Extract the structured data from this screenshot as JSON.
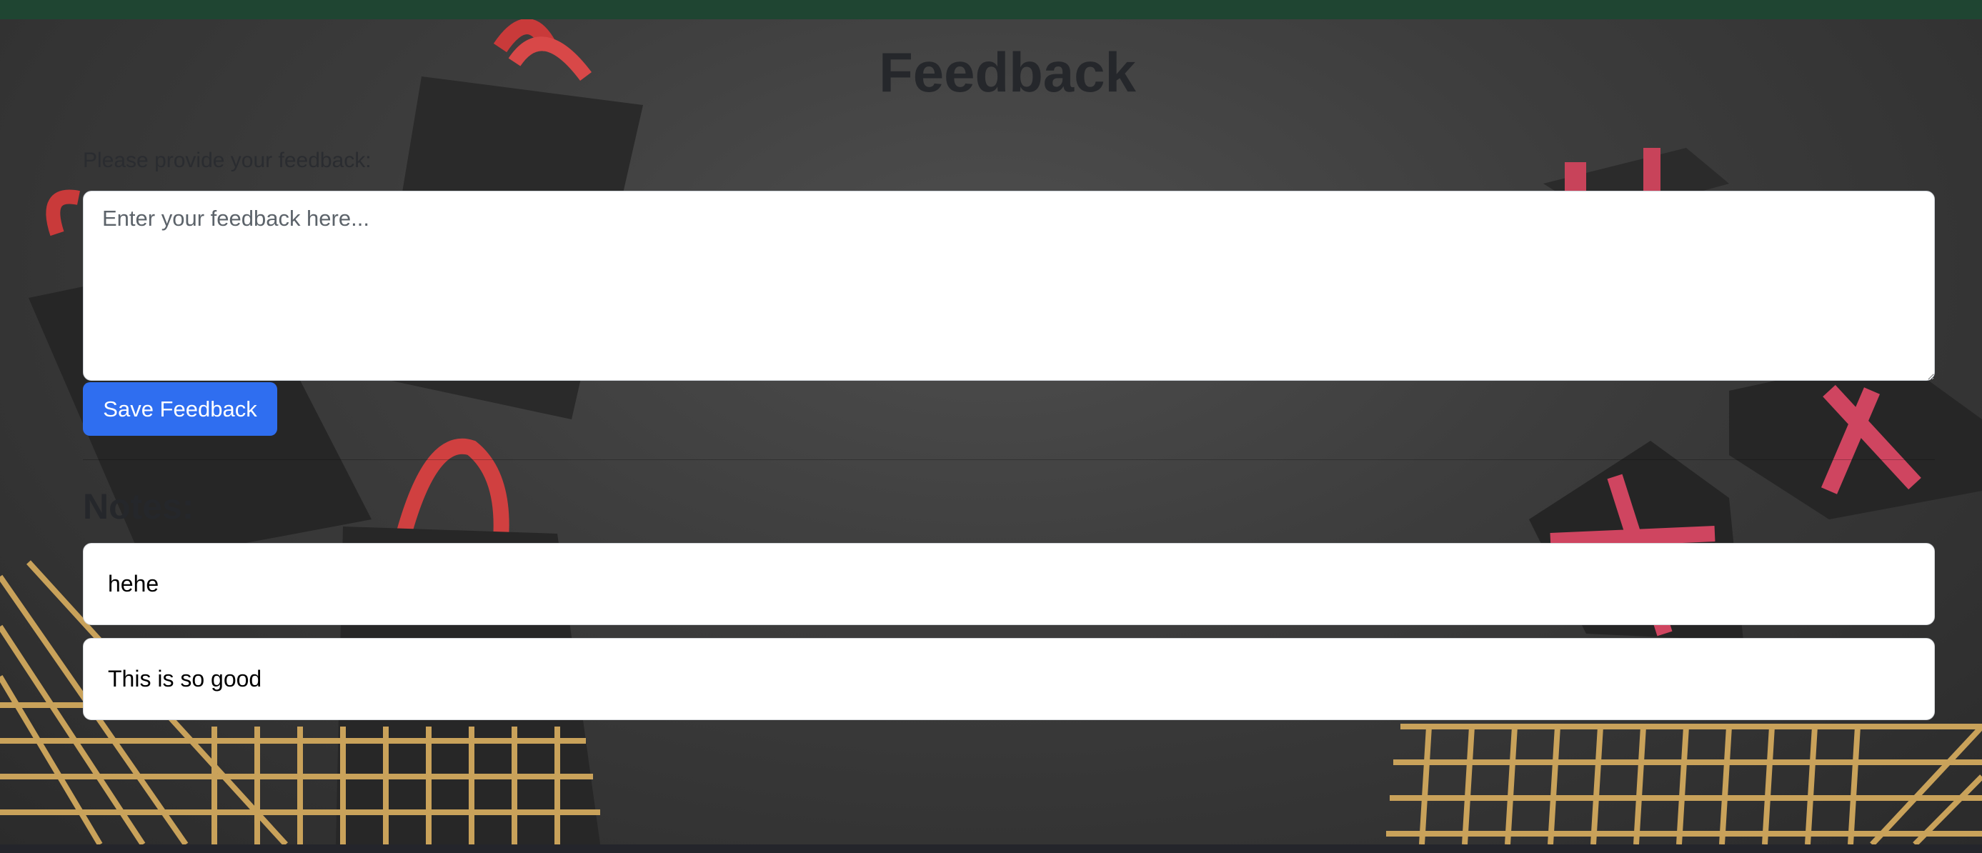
{
  "page": {
    "title": "Feedback"
  },
  "feedback_form": {
    "prompt_label": "Please provide your feedback:",
    "placeholder": "Enter your feedback here...",
    "value": "",
    "save_label": "Save Feedback"
  },
  "notes": {
    "heading": "Notes:",
    "items": [
      {
        "text": "hehe"
      },
      {
        "text": "This is so good"
      }
    ]
  },
  "colors": {
    "top_bar": "#1f4532",
    "save_button": "#2f6ef0",
    "background": "#3c3c3c",
    "bag_handle": "#d23b3b",
    "cart_gold": "#c9a25a"
  }
}
